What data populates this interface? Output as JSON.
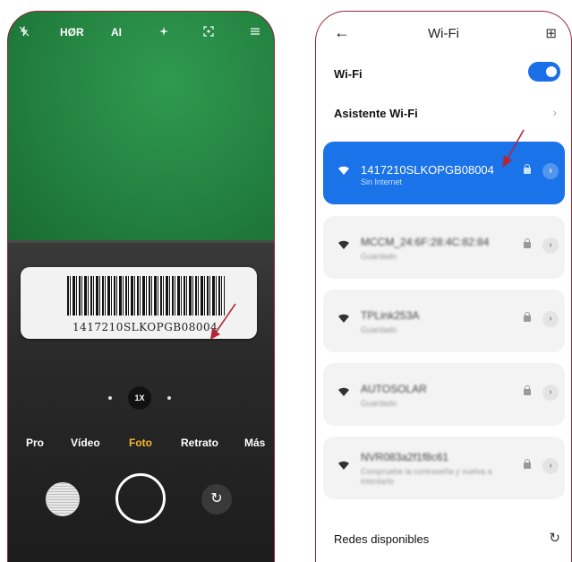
{
  "camera": {
    "top_bar": {
      "flash_icon": "flash-off-icon",
      "hdr": "HØR",
      "ai": "AI",
      "filter_icon": "magic-icon",
      "lens_icon": "focus-icon",
      "menu_icon": "menu-icon"
    },
    "label_code": "1417210SLKOPGB08004",
    "zoom": "1X",
    "modes": [
      "Pro",
      "Vídeo",
      "Foto",
      "Retrato",
      "Más"
    ],
    "active_mode": "Foto",
    "accent_color": "#f5b92c"
  },
  "wifi": {
    "header": {
      "back_icon": "←",
      "title": "Wi-Fi",
      "scan_icon": "⊞"
    },
    "toggle_label": "Wi-Fi",
    "toggle_on": true,
    "assistant_label": "Asistente Wi-Fi",
    "networks": [
      {
        "name": "1417210SLKOPGB08004",
        "status": "Sin Internet",
        "active": true
      },
      {
        "name": "MCCM_24:6F:28:4C:82:84",
        "status": "Guardado",
        "active": false
      },
      {
        "name": "TPLink253A",
        "status": "Guardado",
        "active": false
      },
      {
        "name": "AUTOSOLAR",
        "status": "Guardado",
        "active": false
      },
      {
        "name": "NVR083a2f1f8c61",
        "status": "Compruebe la contraseña y vuelva a intentarlo",
        "active": false
      }
    ],
    "available_label": "Redes disponibles",
    "accent_color": "#1a73e8"
  }
}
